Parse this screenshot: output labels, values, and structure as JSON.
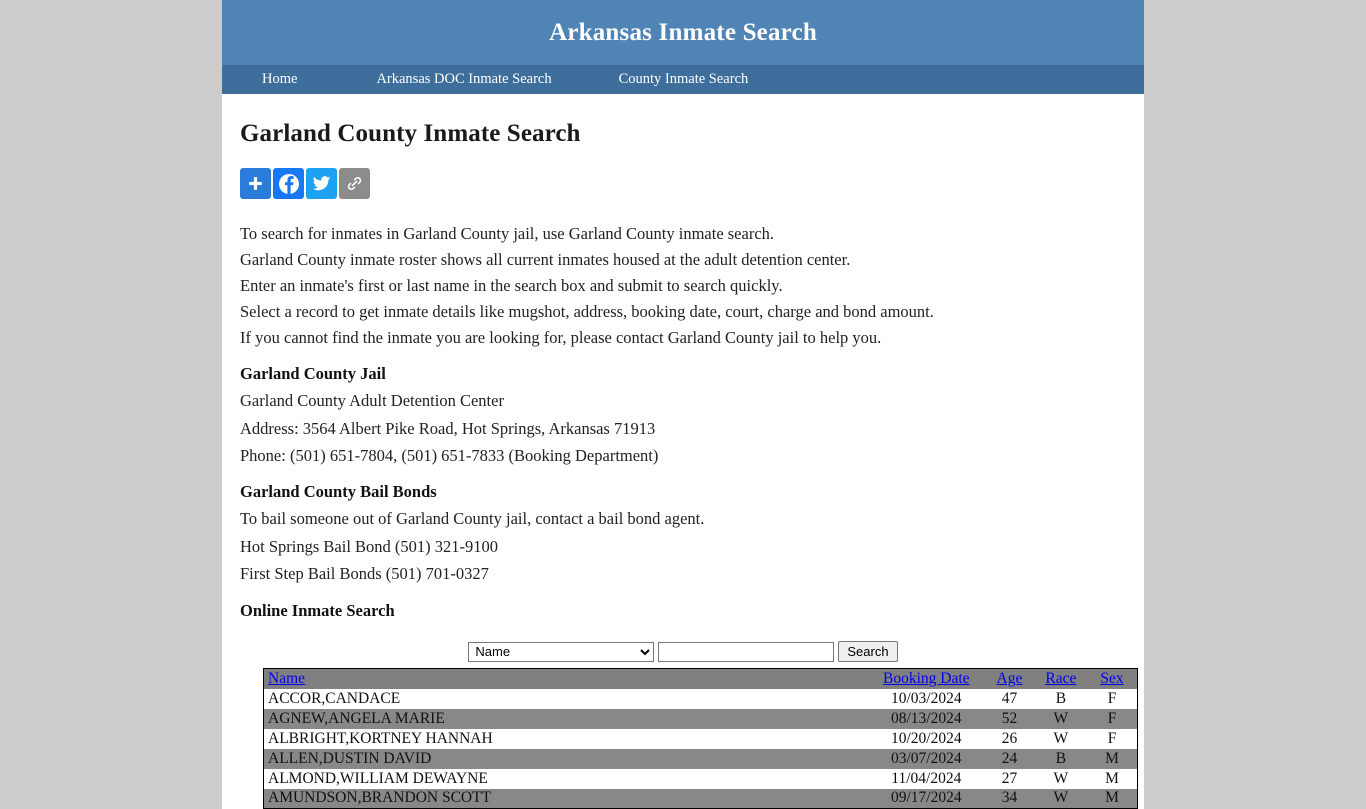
{
  "site": {
    "banner_title": "Arkansas Inmate Search",
    "nav": [
      {
        "label": "Home"
      },
      {
        "label": "Arkansas DOC Inmate Search"
      },
      {
        "label": "County Inmate Search"
      }
    ],
    "colors": {
      "banner_bg": "#5084b5",
      "nav_bg": "#3d6e9c",
      "body_bg": "#cccccc",
      "link": "#0000ee",
      "table_header_bg": "#808080",
      "table_stripe_bg": "#888888"
    }
  },
  "page": {
    "title": "Garland County Inmate Search"
  },
  "share": {
    "buttons": [
      {
        "name": "addthis",
        "label": "Share",
        "color": "#2b7bdb"
      },
      {
        "name": "facebook",
        "label": "Facebook",
        "color": "#1877f2"
      },
      {
        "name": "twitter",
        "label": "Twitter",
        "color": "#1da1f2"
      },
      {
        "name": "copy-link",
        "label": "Copy Link",
        "color": "#8c8c8c"
      }
    ]
  },
  "intro": {
    "lines": [
      "To search for inmates in Garland County jail, use Garland County inmate search.",
      "Garland County inmate roster shows all current inmates housed at the adult detention center.",
      "Enter an inmate's first or last name in the search box and submit to search quickly.",
      "Select a record to get inmate details like mugshot, address, booking date, court, charge and bond amount.",
      "If you cannot find the inmate you are looking for, please contact Garland County jail to help you."
    ]
  },
  "jail": {
    "heading": "Garland County Jail",
    "facility": "Garland County Adult Detention Center",
    "address": "Address: 3564 Albert Pike Road, Hot Springs, Arkansas 71913",
    "phone": "Phone: (501) 651-7804, (501) 651-7833 (Booking Department)"
  },
  "bail": {
    "heading": "Garland County Bail Bonds",
    "intro": "To bail someone out of Garland County jail, contact a bail bond agent.",
    "agents": [
      "Hot Springs Bail Bond (501) 321-9100",
      "First Step Bail Bonds (501) 701-0327"
    ]
  },
  "online_search": {
    "heading": "Online Inmate Search",
    "select_value": "Name",
    "select_options": [
      "Name"
    ],
    "input_value": "",
    "input_placeholder": "",
    "button_label": "Search"
  },
  "roster": {
    "columns": [
      {
        "key": "name",
        "label": "Name"
      },
      {
        "key": "booking_date",
        "label": "Booking Date"
      },
      {
        "key": "age",
        "label": "Age"
      },
      {
        "key": "race",
        "label": "Race"
      },
      {
        "key": "sex",
        "label": "Sex"
      }
    ],
    "rows": [
      {
        "name": "ACCOR,CANDACE",
        "booking_date": "10/03/2024",
        "age": "47",
        "race": "B",
        "sex": "F"
      },
      {
        "name": "AGNEW,ANGELA MARIE",
        "booking_date": "08/13/2024",
        "age": "52",
        "race": "W",
        "sex": "F"
      },
      {
        "name": "ALBRIGHT,KORTNEY HANNAH",
        "booking_date": "10/20/2024",
        "age": "26",
        "race": "W",
        "sex": "F"
      },
      {
        "name": "ALLEN,DUSTIN DAVID",
        "booking_date": "03/07/2024",
        "age": "24",
        "race": "B",
        "sex": "M"
      },
      {
        "name": "ALMOND,WILLIAM DEWAYNE",
        "booking_date": "11/04/2024",
        "age": "27",
        "race": "W",
        "sex": "M"
      },
      {
        "name": "AMUNDSON,BRANDON SCOTT",
        "booking_date": "09/17/2024",
        "age": "34",
        "race": "W",
        "sex": "M"
      }
    ]
  }
}
